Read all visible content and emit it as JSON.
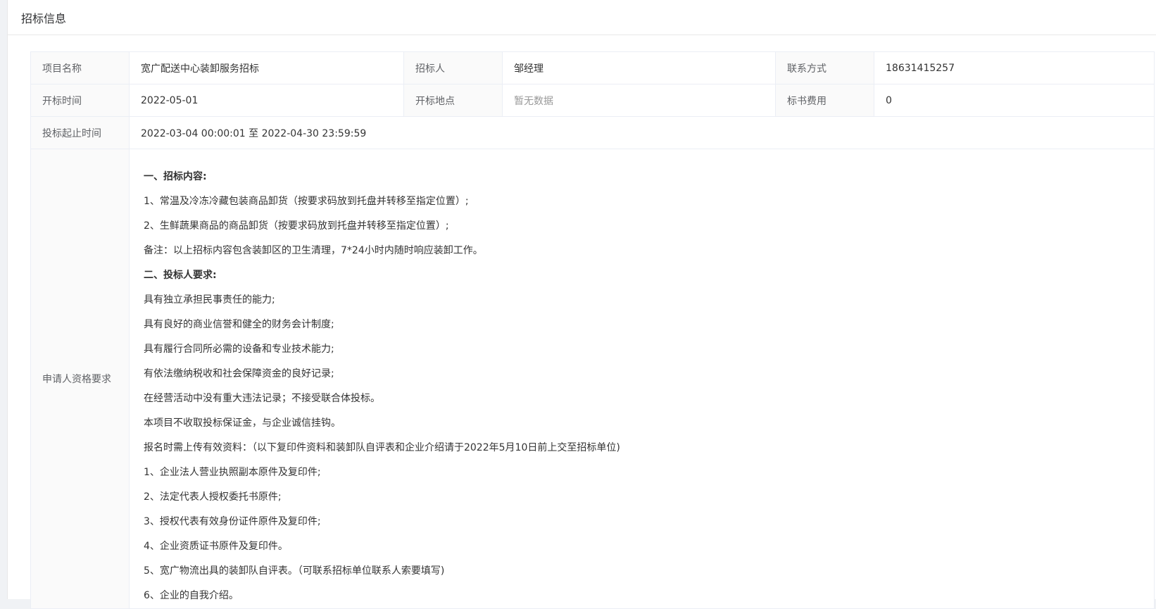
{
  "card": {
    "title": "招标信息"
  },
  "info": {
    "project_name_label": "项目名称",
    "project_name": "宽广配送中心装卸服务招标",
    "tenderer_label": "招标人",
    "tenderer": "邹经理",
    "contact_label": "联系方式",
    "contact": "18631415257",
    "open_time_label": "开标时间",
    "open_time": "2022-05-01",
    "open_place_label": "开标地点",
    "open_place": "暂无数据",
    "doc_fee_label": "标书费用",
    "doc_fee": "0",
    "bid_period_label": "投标起止时间",
    "bid_period": "2022-03-04 00:00:01 至 2022-04-30 23:59:59",
    "requirements_label": "申请人资格要求"
  },
  "requirements": [
    {
      "text": "一、招标内容:",
      "bold": true
    },
    {
      "text": "1、常温及冷冻冷藏包装商品卸货（按要求码放到托盘并转移至指定位置）;",
      "bold": false
    },
    {
      "text": "2、生鲜蔬果商品的商品卸货（按要求码放到托盘并转移至指定位置）;",
      "bold": false
    },
    {
      "text": "备注：以上招标内容包含装卸区的卫生清理，7*24小时内随时响应装卸工作。",
      "bold": false
    },
    {
      "text": "二、投标人要求:",
      "bold": true
    },
    {
      "text": "具有独立承担民事责任的能力;",
      "bold": false
    },
    {
      "text": "具有良好的商业信誉和健全的财务会计制度;",
      "bold": false
    },
    {
      "text": "具有履行合同所必需的设备和专业技术能力;",
      "bold": false
    },
    {
      "text": "有依法缴纳税收和社会保障资金的良好记录;",
      "bold": false
    },
    {
      "text": "在经营活动中没有重大违法记录；不接受联合体投标。",
      "bold": false
    },
    {
      "text": "本项目不收取投标保证金，与企业诚信挂钩。",
      "bold": false
    },
    {
      "text": "报名时需上传有效资料：（以下复印件资料和装卸队自评表和企业介绍请于2022年5月10日前上交至招标单位)",
      "bold": false
    },
    {
      "text": "1、企业法人营业执照副本原件及复印件;",
      "bold": false
    },
    {
      "text": "2、法定代表人授权委托书原件;",
      "bold": false
    },
    {
      "text": "3、授权代表有效身份证件原件及复印件;",
      "bold": false
    },
    {
      "text": "4、企业资质证书原件及复印件。",
      "bold": false
    },
    {
      "text": "5、宽广物流出具的装卸队自评表。（可联系招标单位联系人索要填写)",
      "bold": false
    },
    {
      "text": "6、企业的自我介绍。",
      "bold": false
    }
  ]
}
